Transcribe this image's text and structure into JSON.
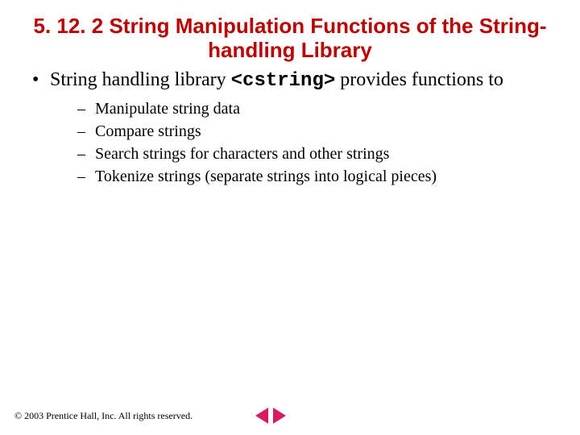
{
  "title": "5. 12. 2 String Manipulation Functions of the String-handling Library",
  "bullet": {
    "pre": "String handling library ",
    "code": "<cstring>",
    "post": " provides functions to"
  },
  "subbullets": [
    "Manipulate string data",
    "Compare strings",
    "Search strings for characters and other strings",
    "Tokenize strings (separate strings into logical pieces)"
  ],
  "copyright": "© 2003 Prentice Hall, Inc.  All rights reserved."
}
